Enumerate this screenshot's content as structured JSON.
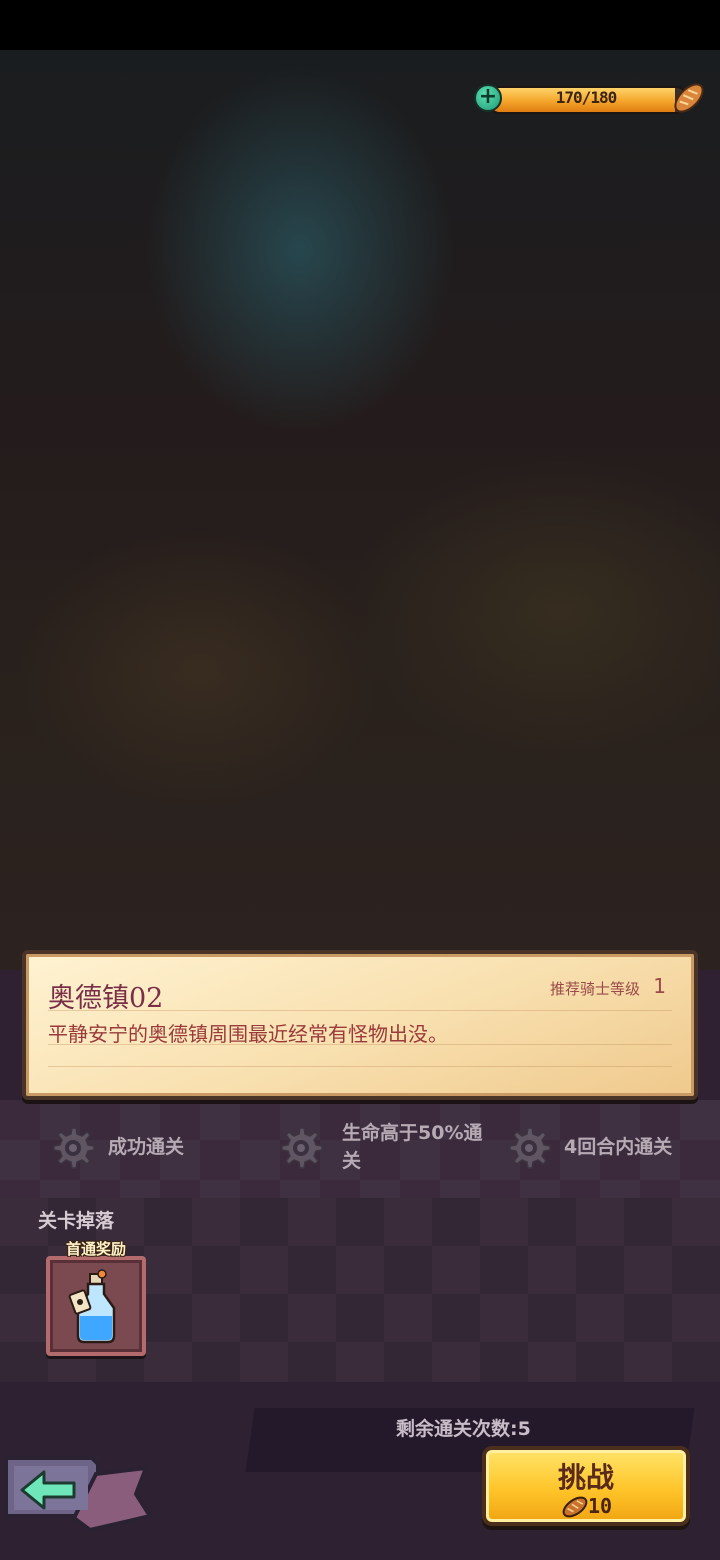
{
  "energy": {
    "value_text": "170/180",
    "current": 170,
    "max": 180,
    "plus_icon": "plus-icon",
    "resource_icon": "bread-icon"
  },
  "stage": {
    "title": "奥德镇02",
    "recommended_label": "推荐骑士等级",
    "recommended_level": "1",
    "description": "平静安宁的奥德镇周围最近经常有怪物出没。"
  },
  "objectives": [
    {
      "icon": "gear-icon",
      "text": "成功通关"
    },
    {
      "icon": "gear-icon",
      "text_line1": "生命高于50%通",
      "text_line2": "关"
    },
    {
      "icon": "gear-icon",
      "text": "4回合内通关"
    }
  ],
  "drops": {
    "title": "关卡掉落",
    "first_clear_tag": "首通奖励",
    "reward_icon": "potion-bottle-icon"
  },
  "remaining": {
    "text": "剩余通关次数:5"
  },
  "challenge": {
    "label": "挑战",
    "cost": "10",
    "cost_icon": "bread-icon"
  },
  "back": {
    "icon": "back-arrow-icon"
  },
  "colors": {
    "energy_fill": "#f4a52a",
    "card_bg": "#f8dfae",
    "title": "#7a2f48",
    "challenge_button": "#ffc52a",
    "panel_bg": "#2f2131"
  }
}
